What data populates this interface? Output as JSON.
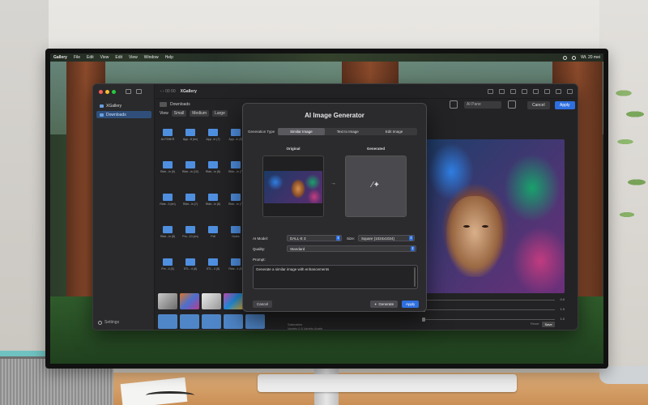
{
  "menubar": {
    "app_name": "Gallery",
    "items": [
      "File",
      "Edit",
      "View",
      "Edit",
      "View",
      "Window",
      "Help"
    ],
    "clock": "Wt. 20 mei"
  },
  "app": {
    "sidebar": {
      "items": [
        "XGallery",
        "Downloads"
      ],
      "settings_label": "Settings"
    },
    "topbar": {
      "nav": "‹ ›  00 00",
      "title": "XGallery"
    },
    "content": {
      "path_label": "Downloads",
      "view_label": "View",
      "view_sizes": [
        "Small",
        "Medium",
        "Large"
      ]
    },
    "grid_labels": [
      "AI-P2MKR",
      "App...8 (en)",
      "App...in (7)",
      "App...in (8)",
      "Ride...in (9)",
      "Ride...in (10)",
      "Ride...in (8)",
      "Ride...in (7)",
      "Ride...3 (en)",
      "Ride...in (7)",
      "Ride...in (8)",
      "Ride...in (7)",
      "Ride...in (8)",
      "Pro...10 (en)",
      "Pdf",
      "Notes",
      "Pre...4 (5)",
      "STL...4 (6)",
      "STL...4 (8)",
      "Ride...4 (8)"
    ],
    "toolbar": {
      "select_label": "AI Pane",
      "cancel": "Cancel",
      "apply": "Apply"
    },
    "sliders": [
      {
        "value": "0.0"
      },
      {
        "value": "1.0"
      },
      {
        "value": "1.0"
      },
      {
        "value": "0.0"
      }
    ],
    "bottom": {
      "label_a": "Saturation",
      "label_b": "Variety 0.5  Variety Angle",
      "reset": "Reset",
      "save": "Save"
    },
    "colors": {
      "accent": "#2e6fe0",
      "window_bg": "#232325",
      "dialog_bg": "#2b2b2e"
    }
  },
  "dialog": {
    "title": "AI Image Generator",
    "generation_type_label": "Generation Type",
    "tabs": [
      "Similar Image",
      "Text to Image",
      "Edit Image"
    ],
    "active_tab_index": 0,
    "original_label": "Original",
    "generated_label": "Generated",
    "ai_model_label": "AI Model:",
    "ai_model_value": "DALL-E 3",
    "size_label": "Size:",
    "size_value": "Square (1024x1024)",
    "quality_label": "Quality:",
    "quality_value": "Standard",
    "prompt_label": "Prompt:",
    "prompt_value": "Generate a similar image with enhancements",
    "cancel_label": "Cancel",
    "generate_label": "Generate",
    "apply_label": "Apply",
    "arrow_icon": "arrow-right-icon",
    "wand_icon": "magic-wand-icon"
  }
}
